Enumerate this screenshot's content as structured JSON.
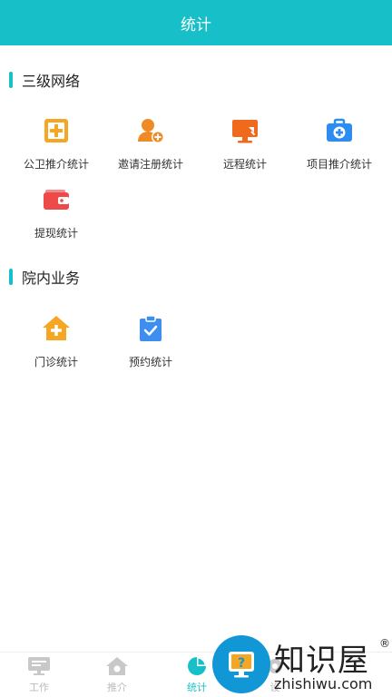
{
  "header": {
    "title": "统计"
  },
  "sections": [
    {
      "title": "三级网络",
      "items": [
        {
          "label": "公卫推介统计",
          "icon": "medical-plus-icon",
          "color": "#f5a623"
        },
        {
          "label": "邀请注册统计",
          "icon": "add-user-icon",
          "color": "#f08a24"
        },
        {
          "label": "远程统计",
          "icon": "remote-monitor-icon",
          "color": "#f06a1e"
        },
        {
          "label": "项目推介统计",
          "icon": "medical-kit-icon",
          "color": "#2d8cf0"
        },
        {
          "label": "提现统计",
          "icon": "wallet-icon",
          "color": "#ef4a4a"
        }
      ]
    },
    {
      "title": "院内业务",
      "items": [
        {
          "label": "门诊统计",
          "icon": "hospital-house-icon",
          "color": "#f5a623"
        },
        {
          "label": "预约统计",
          "icon": "clipboard-check-icon",
          "color": "#3d8ef0"
        }
      ]
    }
  ],
  "tabbar": [
    {
      "label": "工作",
      "icon": "monitor-icon",
      "active": false
    },
    {
      "label": "推介",
      "icon": "home-icon",
      "active": false
    },
    {
      "label": "统计",
      "icon": "pie-chart-icon",
      "active": true
    },
    {
      "label": "设",
      "icon": "settings-icon",
      "active": false
    }
  ],
  "watermark": {
    "text": "知识屋",
    "domain": "zhishiwu.com",
    "reg": "®"
  },
  "colors": {
    "accent": "#17c0c9"
  }
}
